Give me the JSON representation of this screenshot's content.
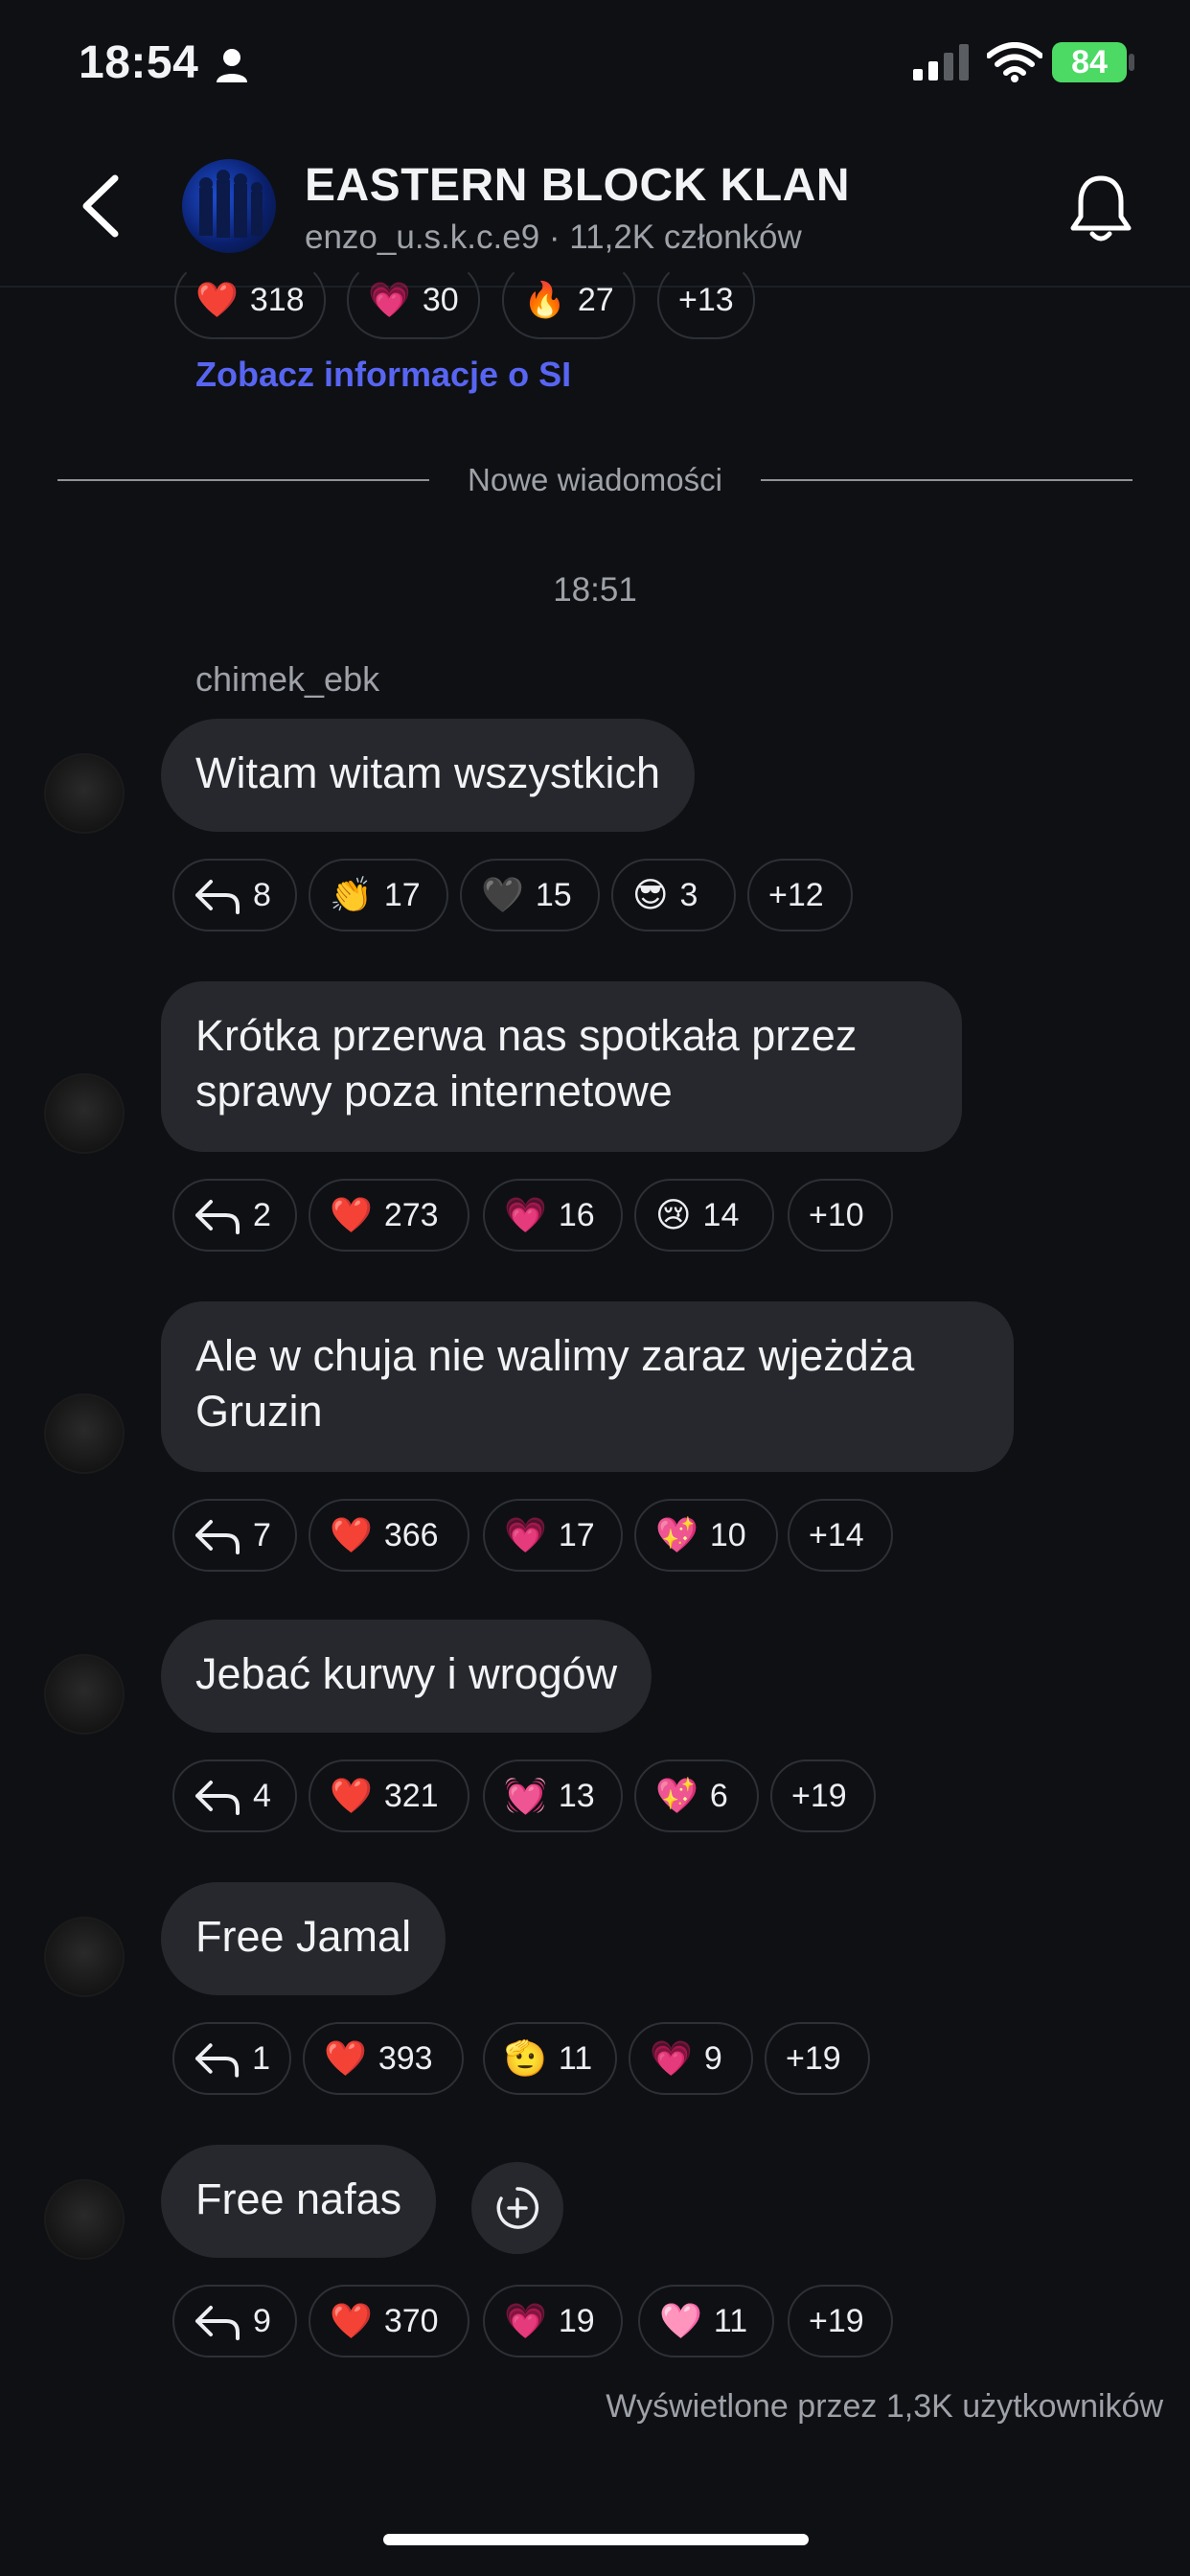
{
  "status_bar": {
    "time": "18:54",
    "battery": "84"
  },
  "header": {
    "title": "EASTERN BLOCK KLAN",
    "subtitle": "enzo_u.s.k.c.e9 · 11,2K członków"
  },
  "top_reactions": [
    {
      "emoji": "❤️",
      "count": "318"
    },
    {
      "emoji": "💗",
      "count": "30"
    },
    {
      "emoji": "🔥",
      "count": "27"
    },
    {
      "emoji": "",
      "count": "+13"
    }
  ],
  "ai_link": "Zobacz informacje o SI",
  "divider": "Nowe wiadomości",
  "timestamp": "18:51",
  "author": "chimek_ebk",
  "messages": [
    {
      "text": "Witam witam wszystkich",
      "replies": "8",
      "reactions": [
        {
          "emoji": "👏",
          "count": "17"
        },
        {
          "emoji": "🖤",
          "count": "15"
        },
        {
          "emoji": "😎",
          "count": "3"
        },
        {
          "emoji": "",
          "count": "+12"
        }
      ]
    },
    {
      "text": "Krótka przerwa nas spotkała przez sprawy poza internetowe",
      "replies": "2",
      "reactions": [
        {
          "emoji": "❤️",
          "count": "273"
        },
        {
          "emoji": "💗",
          "count": "16"
        },
        {
          "emoji": "😢",
          "count": "14"
        },
        {
          "emoji": "",
          "count": "+10"
        }
      ]
    },
    {
      "text": "Ale w chuja nie walimy zaraz wjeżdża Gruzin",
      "replies": "7",
      "reactions": [
        {
          "emoji": "❤️",
          "count": "366"
        },
        {
          "emoji": "💗",
          "count": "17"
        },
        {
          "emoji": "💖",
          "count": "10"
        },
        {
          "emoji": "",
          "count": "+14"
        }
      ]
    },
    {
      "text": "Jebać kurwy i wrogów",
      "replies": "4",
      "reactions": [
        {
          "emoji": "❤️",
          "count": "321"
        },
        {
          "emoji": "💓",
          "count": "13"
        },
        {
          "emoji": "💖",
          "count": "6"
        },
        {
          "emoji": "",
          "count": "+19"
        }
      ]
    },
    {
      "text": "Free Jamal",
      "replies": "1",
      "reactions": [
        {
          "emoji": "❤️",
          "count": "393"
        },
        {
          "emoji": "🫡",
          "count": "11"
        },
        {
          "emoji": "💗",
          "count": "9"
        },
        {
          "emoji": "",
          "count": "+19"
        }
      ]
    },
    {
      "text": "Free nafas",
      "replies": "9",
      "reactions": [
        {
          "emoji": "❤️",
          "count": "370"
        },
        {
          "emoji": "💗",
          "count": "19"
        },
        {
          "emoji": "🩷",
          "count": "11"
        },
        {
          "emoji": "",
          "count": "+19"
        }
      ]
    }
  ],
  "viewed_by": "Wyświetlone przez 1,3K użytkowników",
  "colors": {
    "background": "#0e1014",
    "bubble": "#26282d",
    "accent": "#5865f2",
    "battery": "#4cd964"
  },
  "icons": [
    "person-icon",
    "signal-icon",
    "wifi-icon",
    "battery-icon",
    "back-icon",
    "bell-icon",
    "reply-icon",
    "add-reaction-icon"
  ]
}
